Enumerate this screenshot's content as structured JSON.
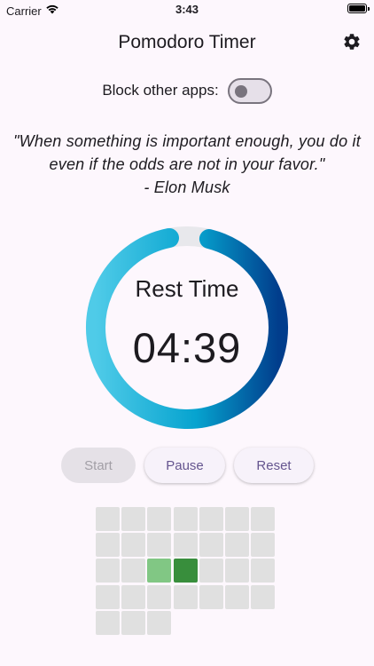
{
  "status_bar": {
    "carrier": "Carrier",
    "time": "3:43",
    "icons": [
      "wifi-icon",
      "battery-icon"
    ]
  },
  "app_bar": {
    "title": "Pomodoro Timer",
    "settings_icon": "gear-icon"
  },
  "block_apps": {
    "label": "Block other apps:",
    "enabled": false
  },
  "quote": {
    "text": "\"When something is important enough, you do it even if the odds are not in your favor.\"",
    "author": "- Elon Musk"
  },
  "timer": {
    "label": "Rest Time",
    "value": "04:39",
    "progress_fraction": 0.93,
    "colors": {
      "light": "#4fcbe8",
      "mid": "#06a3cf",
      "dark": "#013d8c",
      "track": "#e8e8ec"
    }
  },
  "buttons": {
    "start": "Start",
    "pause": "Pause",
    "reset": "Reset"
  },
  "tracker": {
    "total_cells": 31,
    "columns": 7,
    "cells": [
      {
        "status": "empty"
      },
      {
        "status": "empty"
      },
      {
        "status": "empty"
      },
      {
        "status": "empty"
      },
      {
        "status": "empty"
      },
      {
        "status": "empty"
      },
      {
        "status": "empty"
      },
      {
        "status": "empty"
      },
      {
        "status": "empty"
      },
      {
        "status": "empty"
      },
      {
        "status": "empty"
      },
      {
        "status": "empty"
      },
      {
        "status": "empty"
      },
      {
        "status": "empty"
      },
      {
        "status": "empty"
      },
      {
        "status": "empty"
      },
      {
        "status": "light"
      },
      {
        "status": "dark"
      },
      {
        "status": "empty"
      },
      {
        "status": "empty"
      },
      {
        "status": "empty"
      },
      {
        "status": "empty"
      },
      {
        "status": "empty"
      },
      {
        "status": "empty"
      },
      {
        "status": "empty"
      },
      {
        "status": "empty"
      },
      {
        "status": "empty"
      },
      {
        "status": "empty"
      },
      {
        "status": "empty"
      },
      {
        "status": "empty"
      },
      {
        "status": "empty"
      }
    ],
    "colors": {
      "empty": "#e0e0e0",
      "light": "#81c784",
      "dark": "#388e3c"
    }
  }
}
